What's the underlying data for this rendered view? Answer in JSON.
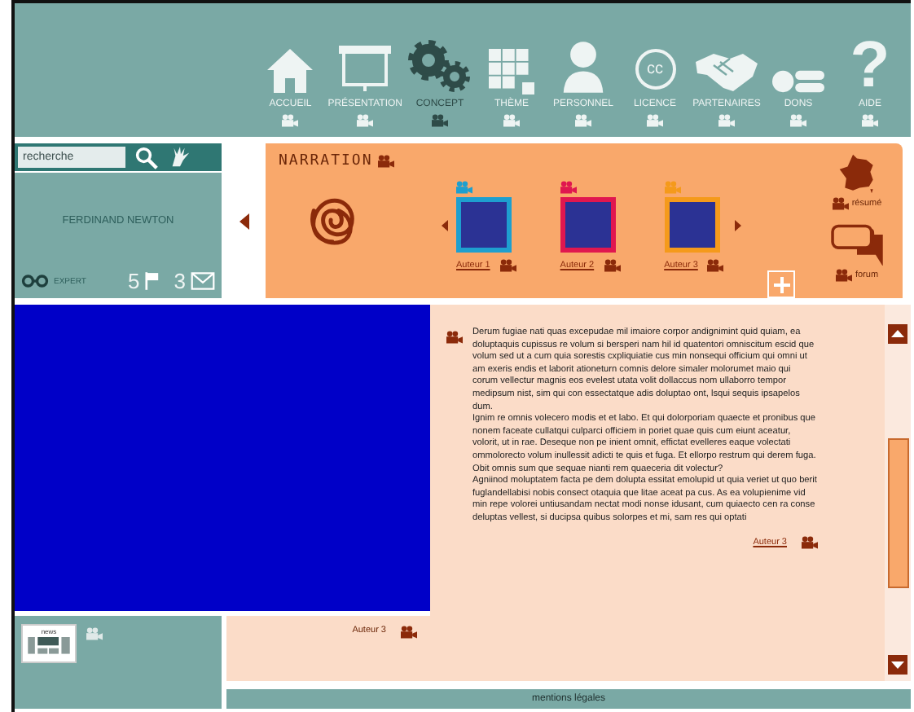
{
  "nav": [
    {
      "label": "ACCUEIL",
      "selected": false,
      "kind": "icon"
    },
    {
      "label": "PRÉSENTATION",
      "selected": false,
      "kind": "icon"
    },
    {
      "label": "CONCEPT",
      "selected": true,
      "kind": "icon"
    },
    {
      "label": "THÈME",
      "selected": false,
      "kind": "icon"
    },
    {
      "label": "PERSONNEL",
      "selected": false,
      "kind": "icon"
    },
    {
      "label": "LICENCE",
      "selected": false,
      "kind": "circled",
      "glyph": "cc"
    },
    {
      "label": "PARTENAIRES",
      "selected": false,
      "kind": "icon"
    },
    {
      "label": "DONS",
      "selected": false,
      "kind": "icon"
    },
    {
      "label": "AIDE",
      "selected": false,
      "kind": "glyph",
      "glyph": "?"
    }
  ],
  "search": {
    "placeholder": "recherche"
  },
  "profile": {
    "name": "FERDINAND NEWTON",
    "rank": "EXPERT",
    "flags": "5",
    "messages": "3"
  },
  "narration": {
    "title": "NARRATION",
    "authors": [
      {
        "label": "Auteur 1",
        "color": "#1e9fcf"
      },
      {
        "label": "Auteur 2",
        "color": "#e0174f"
      },
      {
        "label": "Auteur 3",
        "color": "#f59a1b"
      }
    ],
    "links": [
      "résumé",
      "forum"
    ]
  },
  "video": {
    "caption": "Auteur 3"
  },
  "article": {
    "paragraphs": [
      "Derum fugiae nati quas excepudae mil imaiore corpor andignimint quid quiam, ea doluptaquis cupissus re volum si bersperi nam hil id quatentori omniscitum escid que volum sed ut a cum quia sorestis cxpliquiatie cus min nonsequi officium qui omni ut am exeris endis et laborit ationeturn comnis delore simaler molorumet maio qui corum vellectur magnis eos evelest utata volit dollaccus nom ullaborro tempor medipsum nist, sim qui con essectatque adis doluptao ont, lsqui sequis ipsapelos dum.",
      "Ignim re omnis volecero modis et et labo. Et qui dolorporiam quaecte et pronibus que nonem faceate cullatqui culparci officiem in poriet quae quis cum eiunt aceatur, volorit, ut in rae. Deseque non pe inient omnit, effictat evelleres eaque volectati ommolorecto volum inullessit adicti te quis et fuga. Et ellorpo restrum qui derem fuga. Obit omnis sum que sequae nianti rem quaeceria dit volectur?",
      "Agniinod moluptatem facta pe dem dolupta essitat emolupid ut quia veriet ut quo berit fuglandellabisi nobis consect otaquia que litae aceat pa cus. As ea volupienime vid min repe volorei untiusandam nectat modi nonse idusant, cum quiaecto cen ra conse deluptas vellest, si ducipsa quibus solorpes et mi, sam res qui optati"
    ],
    "author": "Auteur 3"
  },
  "news": {
    "label": "news"
  },
  "footer": "mentions légales"
}
